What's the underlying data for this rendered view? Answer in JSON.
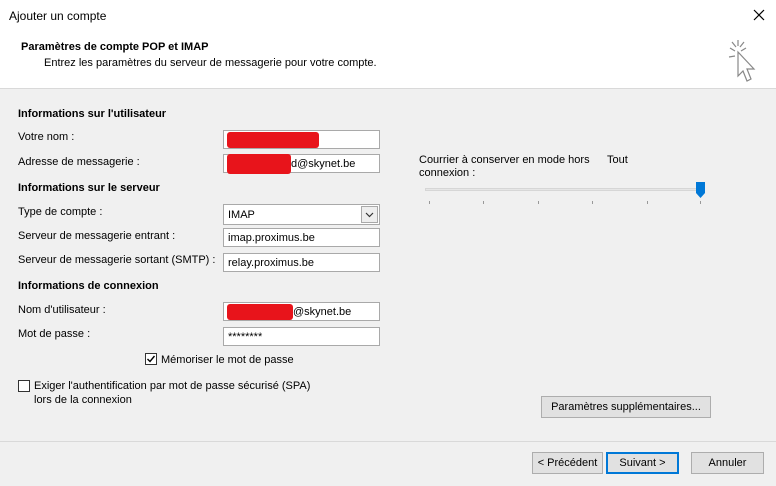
{
  "window": {
    "title": "Ajouter un compte"
  },
  "header": {
    "title": "Paramètres de compte POP et IMAP",
    "subtitle": "Entrez les paramètres du serveur de messagerie pour votre compte."
  },
  "user_info": {
    "section": "Informations sur l'utilisateur",
    "name_label": "Votre nom :",
    "name_value": "",
    "email_label": "Adresse de messagerie :",
    "email_value": "d@skynet.be"
  },
  "server_info": {
    "section": "Informations sur le serveur",
    "account_type_label": "Type de compte :",
    "account_type_value": "IMAP",
    "incoming_label": "Serveur de messagerie entrant :",
    "incoming_value": "imap.proximus.be",
    "outgoing_label": "Serveur de messagerie sortant (SMTP) :",
    "outgoing_value": "relay.proximus.be"
  },
  "login_info": {
    "section": "Informations de connexion",
    "username_label": "Nom d'utilisateur :",
    "username_value": "@skynet.be",
    "password_label": "Mot de passe :",
    "password_value": "********",
    "remember_label": "Mémoriser le mot de passe",
    "remember_checked": true
  },
  "spa": {
    "label_line1": "Exiger l'authentification par mot de passe sécurisé (SPA)",
    "label_line2": "lors de la connexion",
    "checked": false
  },
  "offline": {
    "label_line1": "Courrier à conserver en mode hors",
    "label_line2": "connexion :",
    "value_label": "Tout",
    "slider_level": 1.0
  },
  "buttons": {
    "more_settings": "Paramètres supplémentaires...",
    "previous": "< Précédent",
    "next": "Suivant >",
    "cancel": "Annuler"
  },
  "colors": {
    "accent": "#0078d7",
    "redaction": "#e8141b"
  },
  "icons": {
    "close": "close-icon",
    "cursor": "cursor-click-icon",
    "check": "check-icon",
    "dropdown": "chevron-down-icon"
  }
}
